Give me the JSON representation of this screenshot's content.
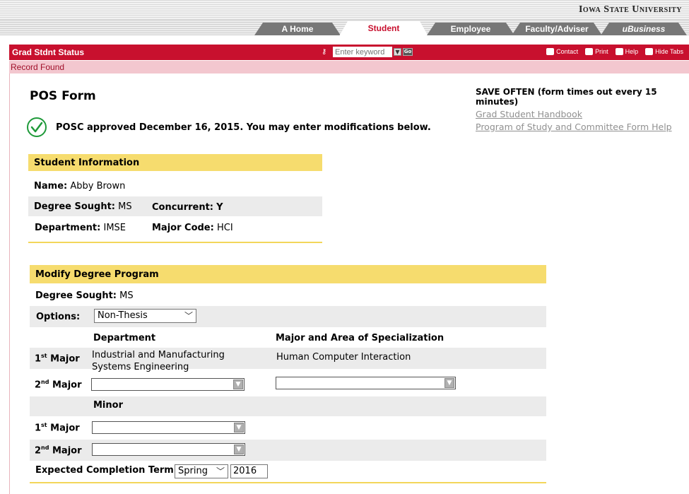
{
  "header": {
    "university": "Iowa State University",
    "tabs": [
      {
        "label": "A Home"
      },
      {
        "label": "Student"
      },
      {
        "label": "Employee"
      },
      {
        "label": "Faculty/Adviser"
      },
      {
        "label": "uBusiness"
      }
    ],
    "page_title": "Grad Stdnt Status",
    "keyword_placeholder": "Enter keyword",
    "go_label": "Go",
    "links": {
      "contact": "Contact",
      "print": "Print",
      "help": "Help",
      "hide_tabs": "Hide Tabs"
    },
    "status": "Record Found"
  },
  "form": {
    "title": "POS Form",
    "approval_message": "POSC approved December 16, 2015. You may enter modifications below.",
    "save_often": "SAVE OFTEN (form times out every 15 minutes)",
    "link_handbook": "Grad Student Handbook",
    "link_help": "Program of Study and Committee Form Help"
  },
  "student_info": {
    "heading": "Student Information",
    "name_label": "Name:",
    "name_value": "Abby Brown",
    "degree_label": "Degree Sought:",
    "degree_value": "MS",
    "concurrent_label": "Concurrent:",
    "concurrent_value": "Y",
    "dept_label": "Department:",
    "dept_value": "IMSE",
    "major_code_label": "Major Code:",
    "major_code_value": "HCI"
  },
  "modify": {
    "heading": "Modify Degree Program",
    "degree_label": "Degree Sought:",
    "degree_value": "MS",
    "options_label": "Options:",
    "options_value": "Non-Thesis",
    "col_department": "Department",
    "col_major": "Major and Area of Specialization",
    "first_major_label_pre": "1",
    "first_major_sup": "st",
    "first_major_label_post": " Major",
    "second_major_label_pre": "2",
    "second_major_sup": "nd",
    "second_major_label_post": "  Major",
    "first_major_dept_line1": "Industrial and Manufacturing",
    "first_major_dept_line2": "Systems Engineering",
    "first_major_area": "Human Computer Interaction",
    "minor_heading": "Minor",
    "expected_label": "Expected Completion Term:",
    "term_value": "Spring",
    "year_value": "2016"
  }
}
